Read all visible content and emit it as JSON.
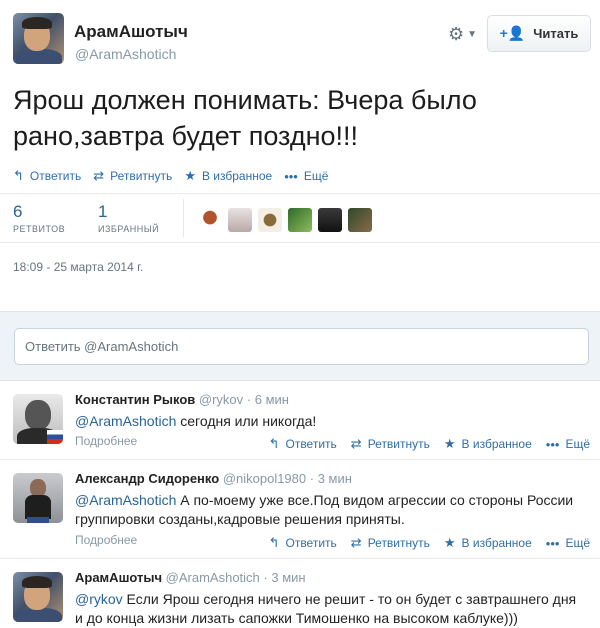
{
  "header": {
    "display_name": "АрамАшотыч",
    "screen_name": "@AramAshotich",
    "follow_label": "Читать"
  },
  "tweet": {
    "text": "Ярош должен понимать: Вчера было рано,завтра будет поздно!!!",
    "actions": {
      "reply": "Ответить",
      "retweet": "Ретвитнуть",
      "favorite": "В избранное",
      "more": "Ещё"
    },
    "stats": {
      "retweets_count": "6",
      "retweets_label": "РЕТВИТОВ",
      "favorites_count": "1",
      "favorites_label": "ИЗБРАННЫЙ"
    },
    "timestamp": "18:09 - 25 марта 2014 г."
  },
  "reply_box": {
    "placeholder": "Ответить @AramAshotich"
  },
  "replies": [
    {
      "name": "Константин Рыков",
      "handle": "@rykov",
      "time": "· 6 мин",
      "mention": "@AramAshotich",
      "text": " сегодня или никогда!",
      "details": "Подробнее"
    },
    {
      "name": "Александр Сидоренко",
      "handle": "@nikopol1980",
      "time": "· 3 мин",
      "mention": "@AramAshotich",
      "text": " А по-моему уже все.Под видом агрессии со стороны России группировки созданы,кадровые решения приняты.",
      "details": "Подробнее"
    },
    {
      "name": "АрамАшотыч",
      "handle": "@AramAshotich",
      "time": "· 3 мин",
      "mention": "@rykov",
      "text": " Если Ярош сегодня ничего не решит - то он  будет с завтрашнего дня и до конца жизни лизать сапожки Тимошенко на высоком каблуке)))"
    }
  ],
  "colors": {
    "link": "#2a6496",
    "muted": "#8899a6",
    "reply_bg": "#eef3f7"
  },
  "icons": [
    "gear-icon",
    "add-user-icon",
    "reply-icon",
    "retweet-icon",
    "star-icon",
    "more-icon"
  ]
}
